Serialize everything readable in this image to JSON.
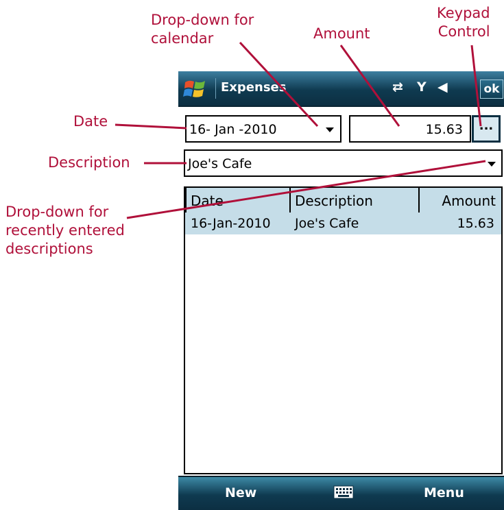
{
  "annotations": {
    "calendar_dropdown": "Drop-down for\ncalendar",
    "amount": "Amount",
    "keypad": "Keypad\nControl",
    "date": "Date",
    "description": "Description",
    "recent_dropdown": "Drop-down for\nrecently entered\ndescriptions"
  },
  "window": {
    "title": "Expenses",
    "ok_label": "ok",
    "start_icon": "windows-flag-icon",
    "status_icons": [
      "sync-disconnected-icon",
      "signal-off-icon",
      "volume-icon"
    ]
  },
  "form": {
    "date_value": "16- Jan -2010",
    "amount_value": "15.63",
    "keypad_label": "...",
    "description_value": "Joe's Cafe"
  },
  "grid": {
    "columns": [
      "Date",
      "Description",
      "Amount"
    ],
    "rows": [
      {
        "date": "16-Jan-2010",
        "description": "Joe's Cafe",
        "amount": "15.63"
      }
    ]
  },
  "menu": {
    "left_label": "New",
    "right_label": "Menu",
    "center_icon": "keyboard-icon"
  },
  "colors": {
    "annotation": "#b0103a",
    "titlebar": "#0f3a50",
    "grid_highlight": "#c5dde8"
  }
}
